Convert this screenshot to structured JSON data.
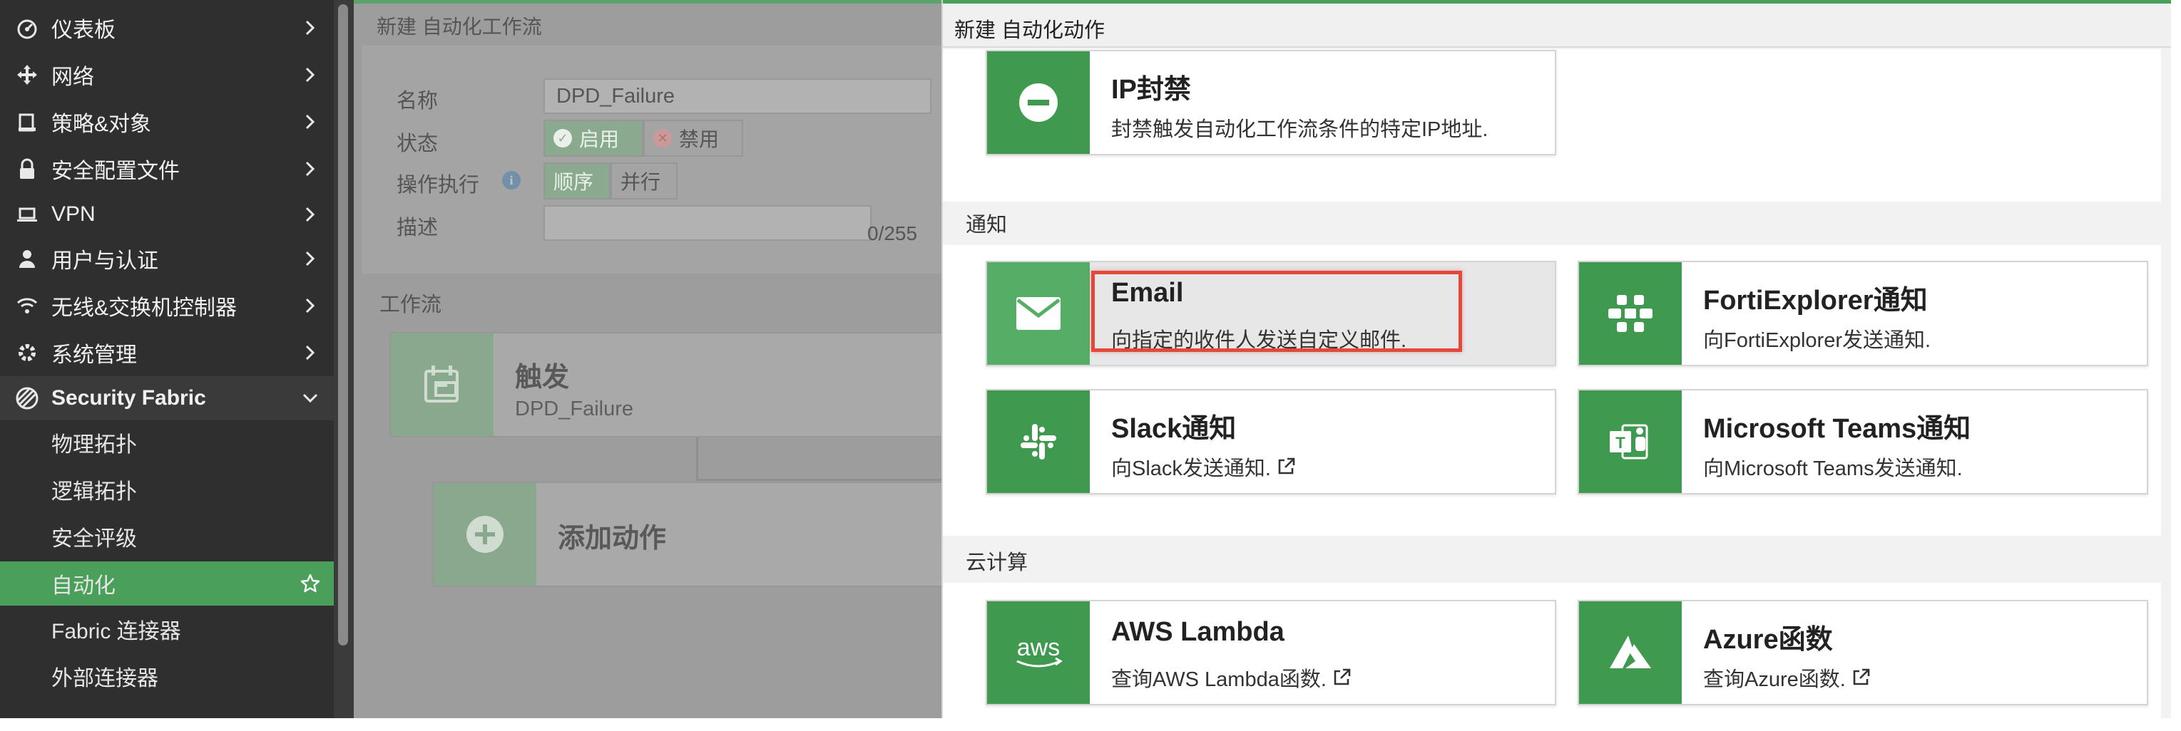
{
  "sidebar": {
    "items": [
      {
        "label": "仪表板",
        "icon": "dashboard-icon"
      },
      {
        "label": "网络",
        "icon": "move-arrows-icon"
      },
      {
        "label": "策略&对象",
        "icon": "clipboard-icon"
      },
      {
        "label": "安全配置文件",
        "icon": "lock-icon"
      },
      {
        "label": "VPN",
        "icon": "laptop-icon"
      },
      {
        "label": "用户与认证",
        "icon": "user-icon"
      },
      {
        "label": "无线&交换机控制器",
        "icon": "wifi-icon"
      },
      {
        "label": "系统管理",
        "icon": "gear-icon"
      },
      {
        "label": "Security Fabric",
        "icon": "fabric-icon"
      }
    ],
    "sub_items": [
      {
        "label": "物理拓扑"
      },
      {
        "label": "逻辑拓扑"
      },
      {
        "label": "安全评级"
      },
      {
        "label": "自动化"
      },
      {
        "label": "Fabric 连接器"
      },
      {
        "label": "外部连接器"
      }
    ]
  },
  "page": {
    "title": "新建 自动化工作流",
    "form": {
      "name_label": "名称",
      "name_value": "DPD_Failure",
      "status_label": "状态",
      "status_on": "启用",
      "status_off": "禁用",
      "exec_label": "操作执行",
      "exec_seq": "顺序",
      "exec_par": "并行",
      "desc_label": "描述",
      "desc_counter": "0/255"
    },
    "workflow": {
      "heading": "工作流",
      "trigger_title": "触发",
      "trigger_sub": "DPD_Failure",
      "add_action": "添加动作"
    }
  },
  "panel": {
    "title": "新建 自动化动作",
    "ip_ban": {
      "title": "IP封禁",
      "desc": "封禁触发自动化工作流条件的特定IP地址."
    },
    "notify_heading": "通知",
    "email": {
      "title": "Email",
      "desc": "向指定的收件人发送自定义邮件."
    },
    "fortiexplorer": {
      "title": "FortiExplorer通知",
      "desc": "向FortiExplorer发送通知."
    },
    "slack": {
      "title": "Slack通知",
      "desc": "向Slack发送通知."
    },
    "teams": {
      "title": "Microsoft Teams通知",
      "desc": "向Microsoft Teams发送通知."
    },
    "cloud_heading": "云计算",
    "aws": {
      "title": "AWS Lambda",
      "desc": "查询AWS Lambda函数.",
      "logo_text": "aws"
    },
    "azure": {
      "title": "Azure函数",
      "desc": "查询Azure函数."
    }
  },
  "colors": {
    "accent_green": "#3f9a50",
    "active_green": "#4aa05a",
    "highlight_red": "#e4473b",
    "sidebar_bg": "#2f2f2f"
  }
}
